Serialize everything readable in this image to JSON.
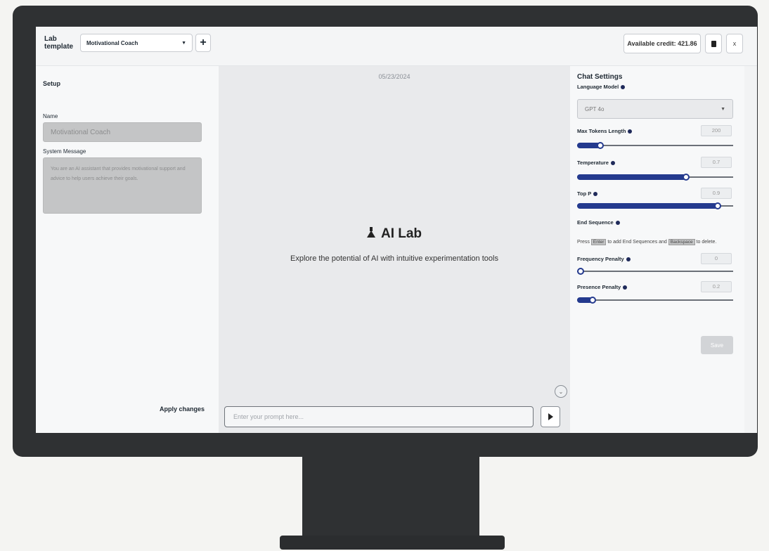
{
  "header": {
    "lab_template_label": "Lab template",
    "template_select_value": "Motivational Coach",
    "add_button": "+",
    "credit_label": "Available credit: 421.86",
    "close_label": "x"
  },
  "setup": {
    "title": "Setup",
    "name_label": "Name",
    "name_value": "Motivational Coach",
    "system_message_label": "System Message",
    "system_message_value": "You are an AI assistant that provides motivational support and advice to help users achieve their goals.",
    "apply_label": "Apply changes"
  },
  "center": {
    "date": "05/23/2024",
    "hero_title": "AI Lab",
    "hero_subtitle": "Explore the potential of AI with intuitive experimentation tools",
    "prompt_placeholder": "Enter your prompt here..."
  },
  "settings": {
    "title": "Chat Settings",
    "language_model_label": "Language Model",
    "language_model_value": "GPT 4o",
    "max_tokens_label": "Max Tokens Length",
    "max_tokens_value": "200",
    "max_tokens_level": 0.15,
    "temperature_label": "Temperature",
    "temperature_value": "0.7",
    "temperature_level": 0.7,
    "top_p_label": "Top P",
    "top_p_value": "0.9",
    "top_p_level": 0.9,
    "stop_sequence_label": "End Sequence",
    "stop_text_1": "Press",
    "stop_key_enter": "Enter",
    "stop_text_2": "to add End Sequences and",
    "stop_key_backspace": "Backspace",
    "stop_text_3": "to delete.",
    "frequency_label": "Frequency Penalty",
    "frequency_value": "0",
    "frequency_level": 0,
    "presence_label": "Presence Penalty",
    "presence_value": "0.2",
    "presence_level": 0.1,
    "save_label": "Save"
  },
  "colors": {
    "accent": "#243a8e",
    "bezel": "#2f3133"
  }
}
